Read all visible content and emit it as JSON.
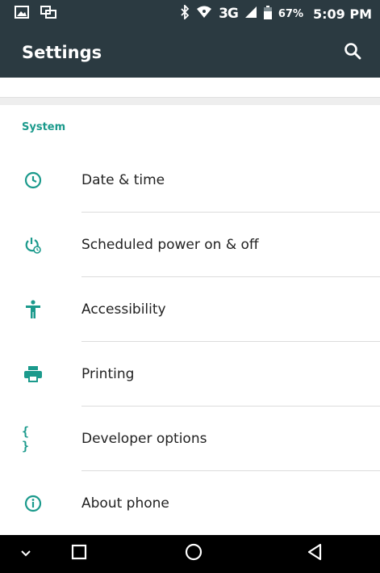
{
  "status_bar": {
    "network": "3G",
    "battery_percent": "67%",
    "time": "5:09 PM"
  },
  "app_bar": {
    "title": "Settings"
  },
  "section": {
    "header": "System",
    "items": [
      {
        "label": "Date & time",
        "icon": "clock-icon"
      },
      {
        "label": "Scheduled power on & off",
        "icon": "power-schedule-icon"
      },
      {
        "label": "Accessibility",
        "icon": "accessibility-icon"
      },
      {
        "label": "Printing",
        "icon": "printer-icon"
      },
      {
        "label": "Developer options",
        "icon": "code-braces-icon",
        "glyph": "{ }"
      },
      {
        "label": "About phone",
        "icon": "info-icon"
      }
    ]
  },
  "colors": {
    "accent": "#1b9a8c",
    "toolbar": "#2b3a41",
    "nav_bar": "#000000"
  }
}
